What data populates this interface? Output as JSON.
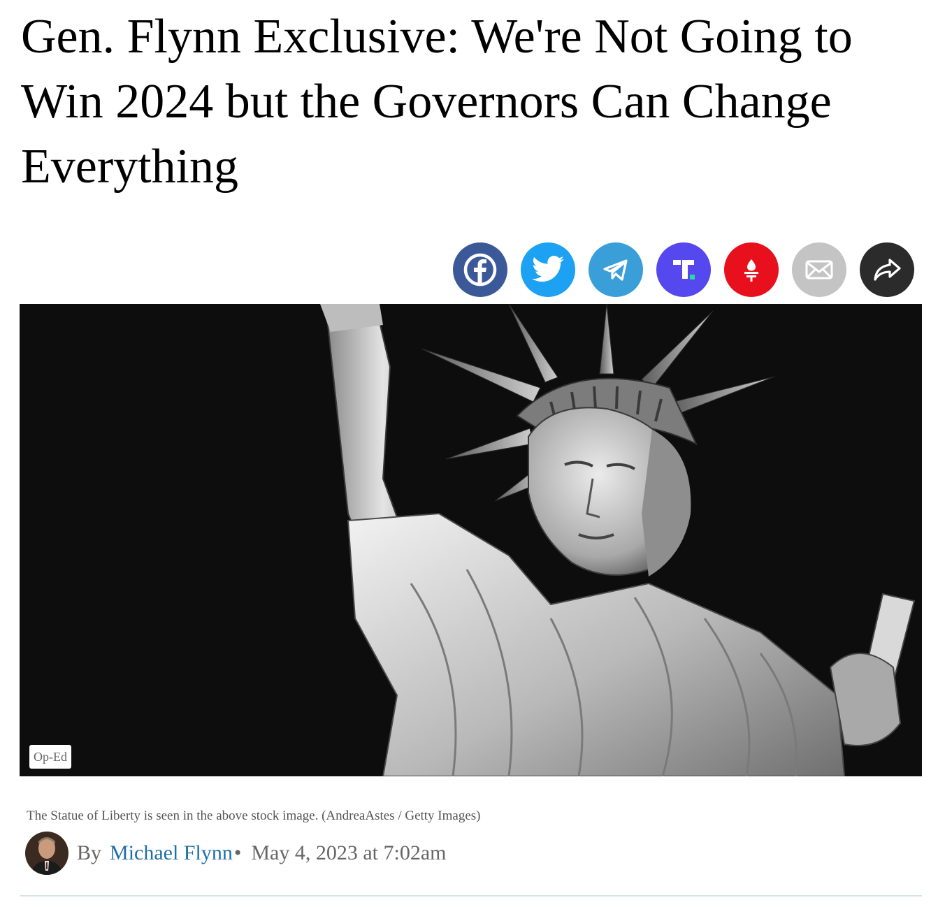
{
  "article": {
    "headline": "Gen. Flynn Exclusive: We're Not Going to Win 2024 but the Governors Can Change Everything",
    "category": "Op-Ed",
    "caption": "The Statue of Liberty is seen in the above stock image. (AndreaAstes / Getty Images)",
    "byline": {
      "by_label": "By",
      "author": "Michael Flynn",
      "separator": "•",
      "date": "May 4, 2023 at 7:02am"
    }
  },
  "share_buttons": [
    {
      "icon": "facebook-icon",
      "color": "#3b5998"
    },
    {
      "icon": "twitter-icon",
      "color": "#1da1f2"
    },
    {
      "icon": "telegram-icon",
      "color": "#3a9fd8"
    },
    {
      "icon": "truth-social-icon",
      "color": "#5448ee"
    },
    {
      "icon": "gettr-icon",
      "color": "#e8101c"
    },
    {
      "icon": "email-icon",
      "color": "#c4c4c4"
    },
    {
      "icon": "share-arrow-icon",
      "color": "#2b2b2b"
    }
  ],
  "colors": {
    "author_link": "#1d6fa5",
    "meta_text": "#666666",
    "divider": "#d7e3ea"
  }
}
